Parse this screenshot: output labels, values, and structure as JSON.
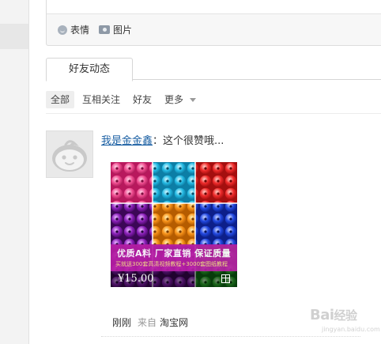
{
  "composer": {
    "emoji_label": "表情",
    "photo_label": "图片"
  },
  "tabs": [
    {
      "label": "好友动态",
      "active": true
    }
  ],
  "filters": [
    {
      "label": "全部",
      "active": true
    },
    {
      "label": "互相关注",
      "active": false
    },
    {
      "label": "好友",
      "active": false
    },
    {
      "label": "更多",
      "active": false,
      "has_dropdown": true
    }
  ],
  "feed": {
    "items": [
      {
        "author": "我是金金鑫",
        "separator": "：",
        "text": "这个很赞哦...",
        "product": {
          "banner_title": "优质A料  厂家直销  保证质量",
          "banner_subtitle": "买就送300套高清视频教程+3000套图纸教程",
          "price": "¥15.00"
        },
        "time": "刚刚",
        "from_label": "来自",
        "source": "淘宝网"
      }
    ]
  },
  "watermark": {
    "text": "Bai",
    "text2": "经验",
    "sub": "jingyan.baidu.com"
  },
  "colors": {
    "link": "#1a5fa3",
    "banner": "#b51ea3"
  }
}
